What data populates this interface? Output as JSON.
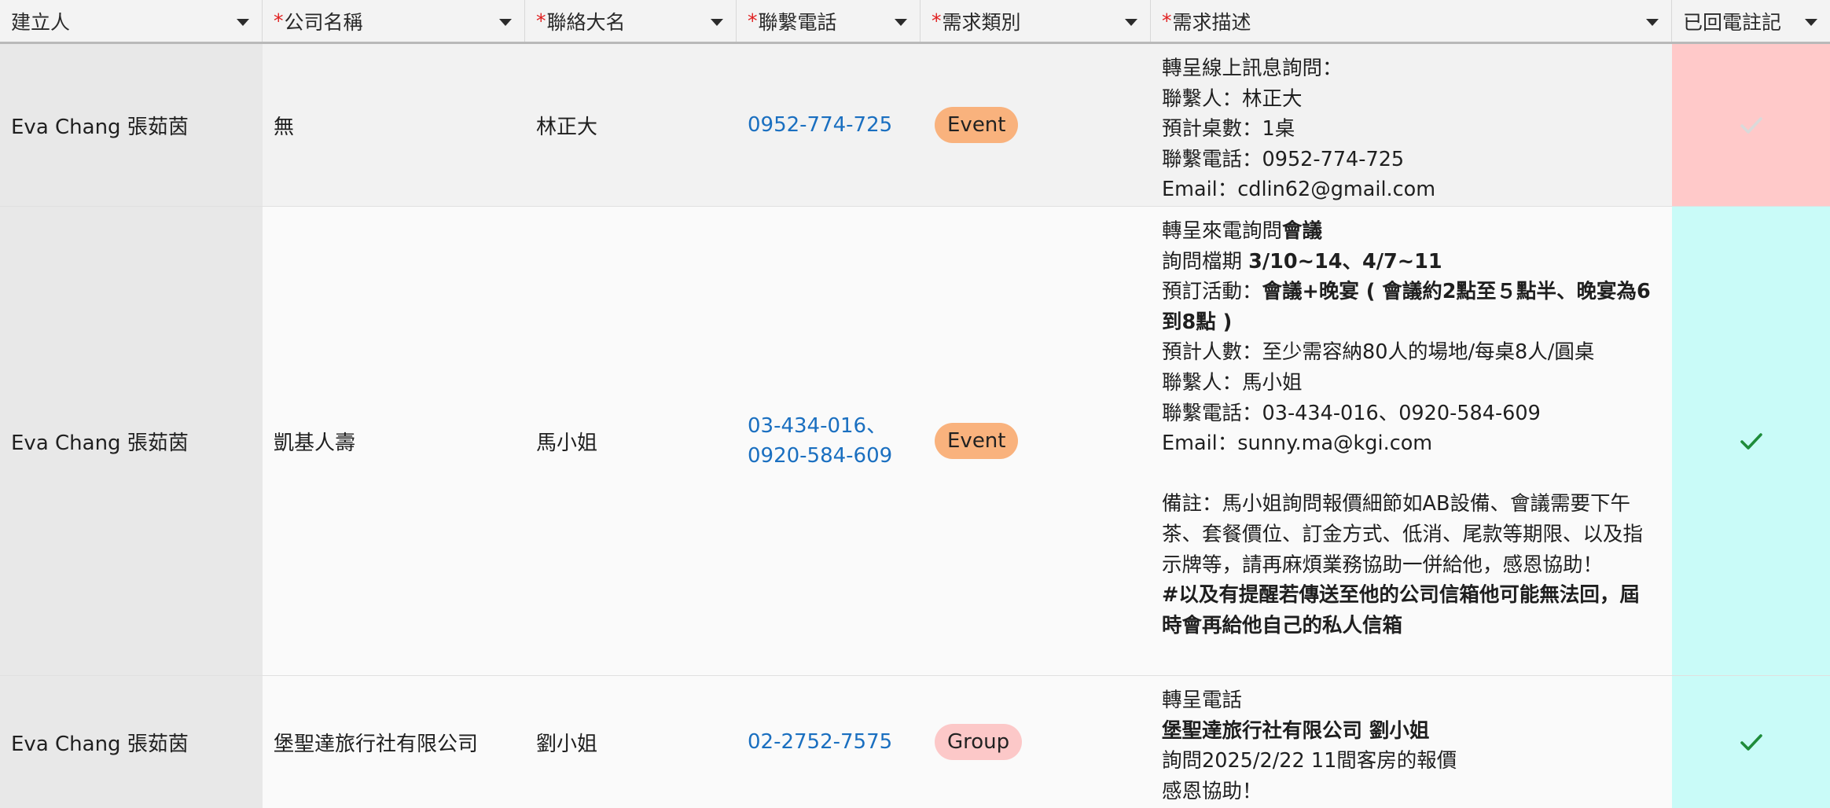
{
  "columns": [
    {
      "label": "建立人",
      "required": false
    },
    {
      "label": "公司名稱",
      "required": true
    },
    {
      "label": "聯絡大名",
      "required": true
    },
    {
      "label": "聯繫電話",
      "required": true
    },
    {
      "label": "需求類別",
      "required": true
    },
    {
      "label": "需求描述",
      "required": true
    },
    {
      "label": "已回電註記",
      "required": false
    }
  ],
  "colors": {
    "required_star": "#e02020",
    "phone_link": "#1a6fc0",
    "event_pill": "#f9b27d",
    "group_pill": "#fcc8c8",
    "callback_not_done_bg": "#ffc9c9",
    "callback_done_bg": "#c9fbf8",
    "check_done": "#1e8c3a",
    "check_not_done": "#dadada"
  },
  "rows": [
    {
      "creator": "Eva Chang 張茹茵",
      "company": "無",
      "contact": "林正大",
      "phone_lines": [
        "0952-774-725"
      ],
      "category": "Event",
      "description": [
        [
          {
            "t": "轉呈線上訊息詢問：",
            "b": false
          }
        ],
        [
          {
            "t": "聯繫人：林正大",
            "b": false
          }
        ],
        [
          {
            "t": "預計桌數：1桌",
            "b": false
          }
        ],
        [
          {
            "t": "聯繫電話：0952-774-725",
            "b": false
          }
        ],
        [
          {
            "t": "Email：cdlin62@gmail.com",
            "b": false
          }
        ]
      ],
      "called_back": false
    },
    {
      "creator": "Eva Chang 張茹茵",
      "company": "凱基人壽",
      "contact": "馬小姐",
      "phone_lines": [
        "03-434-016、",
        "0920-584-609"
      ],
      "category": "Event",
      "description": [
        [
          {
            "t": "轉呈來電詢問",
            "b": false
          },
          {
            "t": "會議",
            "b": true
          }
        ],
        [
          {
            "t": "詢問檔期 ",
            "b": false
          },
          {
            "t": "3/10~14、4/7~11",
            "b": true
          }
        ],
        [
          {
            "t": "預訂活動：",
            "b": false
          },
          {
            "t": "會議+晚宴 ( 會議約2點至５點半、晚宴為6",
            "b": true
          }
        ],
        [
          {
            "t": "到8點 )",
            "b": true
          }
        ],
        [
          {
            "t": "預計人數：至少需容納80人的場地/每桌8人/圓桌",
            "b": false
          }
        ],
        [
          {
            "t": "聯繫人：馬小姐",
            "b": false
          }
        ],
        [
          {
            "t": "聯繫電話：03-434-016、0920-584-609",
            "b": false
          }
        ],
        [
          {
            "t": "Email：sunny.ma@kgi.com",
            "b": false
          }
        ],
        [],
        [
          {
            "t": "備註：馬小姐詢問報價細節如AB設備、會議需要下午",
            "b": false
          }
        ],
        [
          {
            "t": "茶、套餐價位、訂金方式、低消、尾款等期限、以及指",
            "b": false
          }
        ],
        [
          {
            "t": "示牌等，請再麻煩業務協助一併給他，感恩協助！",
            "b": false
          }
        ],
        [
          {
            "t": "#以及有提醒若傳送至他的公司信箱他可能無法回，屆",
            "b": true
          }
        ],
        [
          {
            "t": "時會再給他自己的私人信箱",
            "b": true
          }
        ]
      ],
      "called_back": true
    },
    {
      "creator": "Eva Chang 張茹茵",
      "company": "堡聖達旅行社有限公司",
      "contact": "劉小姐",
      "phone_lines": [
        "02-2752-7575"
      ],
      "category": "Group",
      "description": [
        [
          {
            "t": "轉呈電話",
            "b": false
          }
        ],
        [
          {
            "t": "堡聖達旅行社有限公司 劉小姐",
            "b": true
          }
        ],
        [
          {
            "t": "詢問2025/2/22 11間客房的報價",
            "b": false
          }
        ],
        [
          {
            "t": "感恩協助！",
            "b": false
          }
        ]
      ],
      "called_back": true
    }
  ]
}
